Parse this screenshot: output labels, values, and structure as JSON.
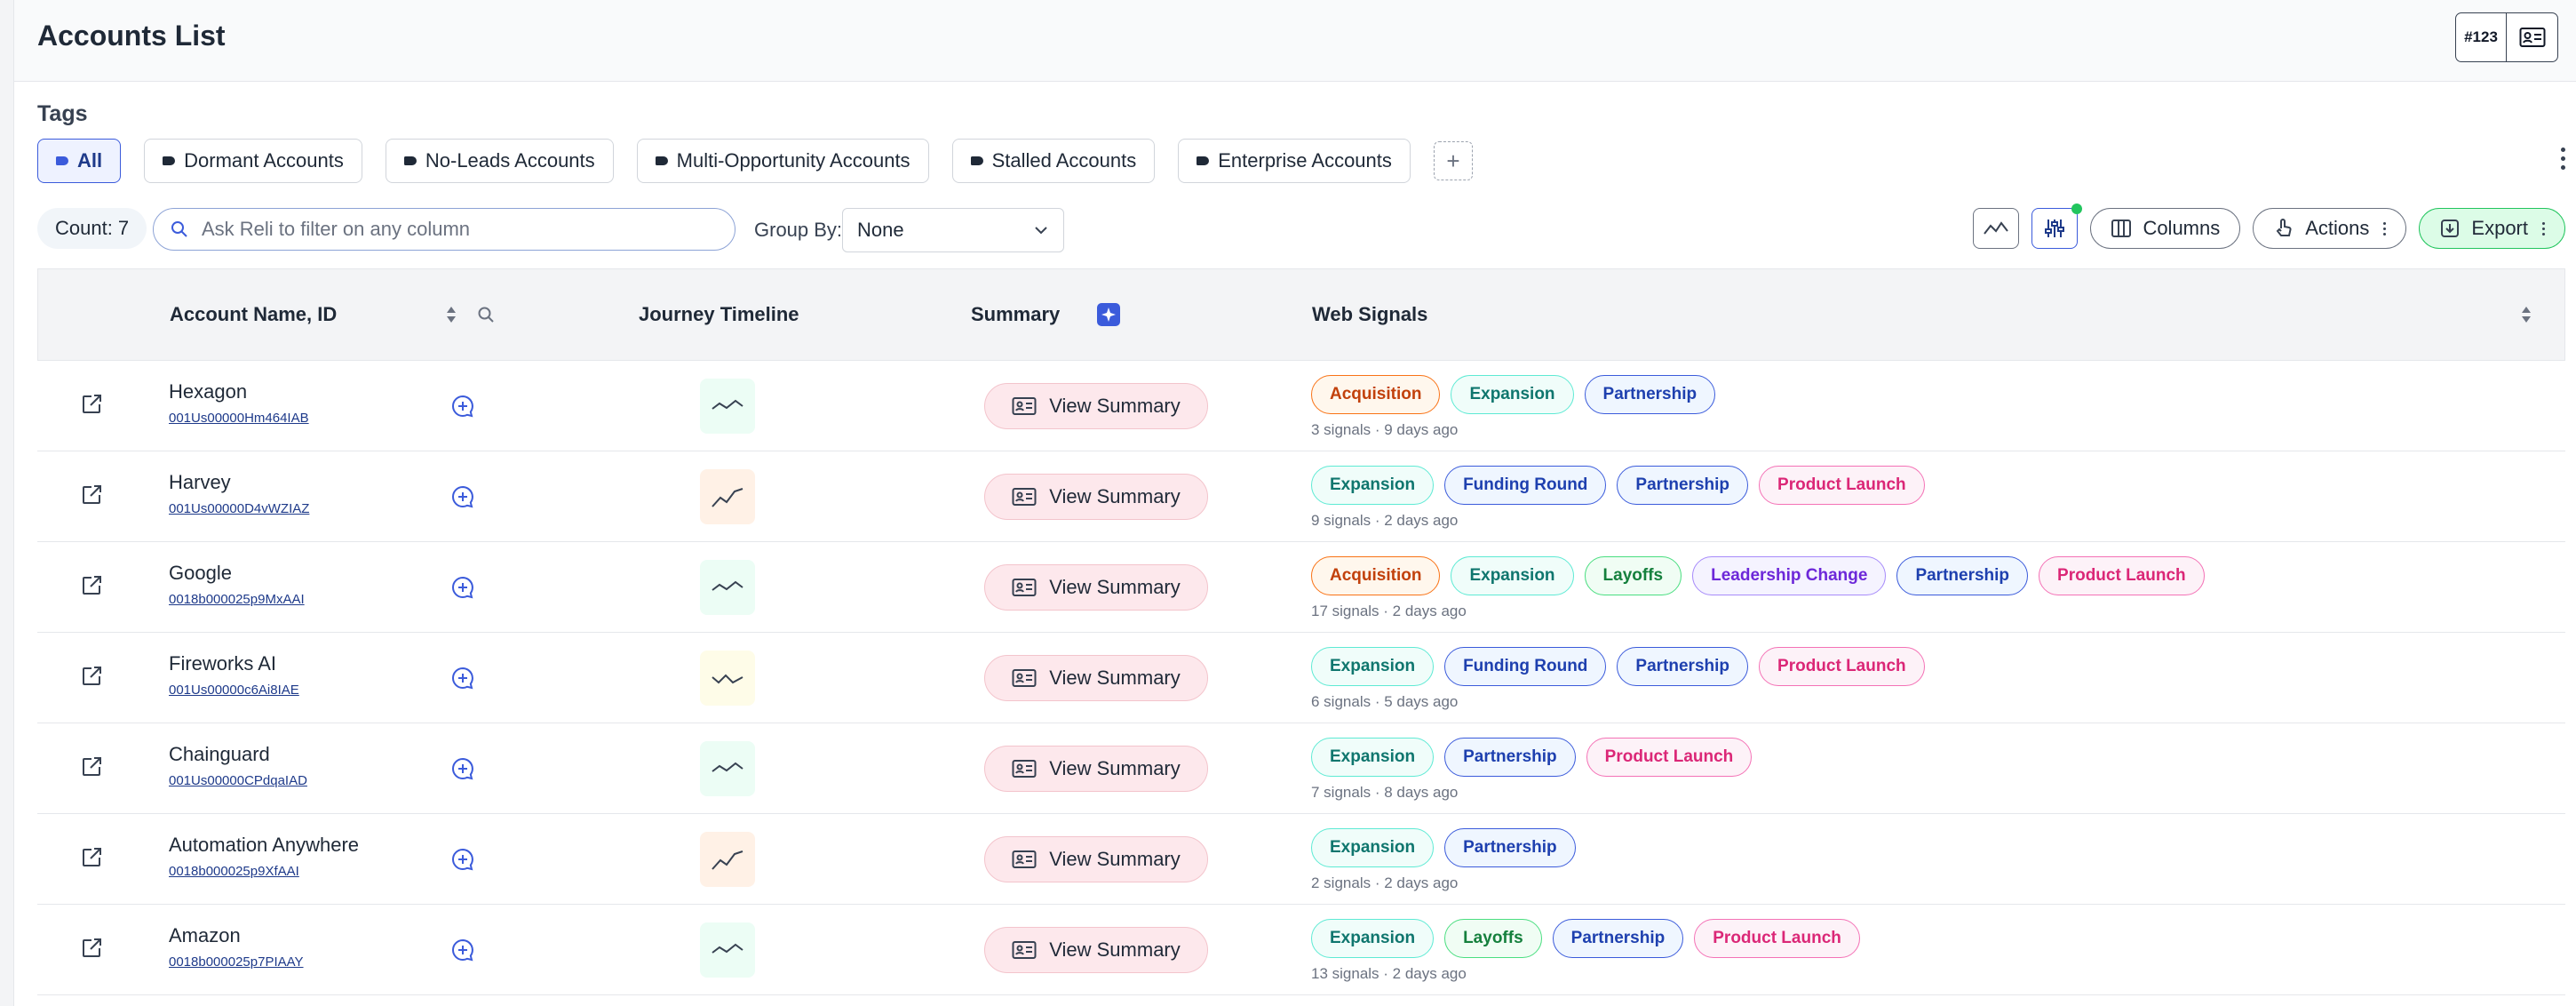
{
  "page": {
    "title": "Accounts List",
    "header_id_label": "#123"
  },
  "tags": {
    "label": "Tags",
    "items": [
      {
        "label": "All",
        "active": true
      },
      {
        "label": "Dormant Accounts"
      },
      {
        "label": "No-Leads Accounts"
      },
      {
        "label": "Multi-Opportunity Accounts"
      },
      {
        "label": "Stalled Accounts"
      },
      {
        "label": "Enterprise Accounts"
      }
    ],
    "add_label": "+"
  },
  "toolbar": {
    "count": "Count: 7",
    "search_placeholder": "Ask Reli to filter on any column",
    "group_by_label": "Group By:",
    "group_by_value": "None",
    "columns_label": "Columns",
    "actions_label": "Actions",
    "export_label": "Export"
  },
  "table": {
    "headers": {
      "account": "Account Name, ID",
      "journey": "Journey Timeline",
      "summary": "Summary",
      "signals": "Web Signals"
    },
    "view_summary_label": "View Summary",
    "rows": [
      {
        "name": "Hexagon",
        "id": "001Us00000Hm464IAB",
        "journey_icon": "trend-flat-icon",
        "journey_color": "green",
        "signals": [
          "Acquisition",
          "Expansion",
          "Partnership"
        ],
        "meta": "3 signals · 9 days ago"
      },
      {
        "name": "Harvey",
        "id": "001Us00000D4vWZIAZ",
        "journey_icon": "trend-up-icon",
        "journey_color": "orange",
        "signals": [
          "Expansion",
          "Funding Round",
          "Partnership",
          "Product Launch"
        ],
        "meta": "9 signals · 2 days ago"
      },
      {
        "name": "Google",
        "id": "0018b000025p9MxAAI",
        "journey_icon": "trend-flat-icon",
        "journey_color": "green",
        "signals": [
          "Acquisition",
          "Expansion",
          "Layoffs",
          "Leadership Change",
          "Partnership",
          "Product Launch"
        ],
        "meta": "17 signals · 2 days ago"
      },
      {
        "name": "Fireworks AI",
        "id": "001Us00000c6Ai8IAE",
        "journey_icon": "trend-wave-icon",
        "journey_color": "yellow",
        "signals": [
          "Expansion",
          "Funding Round",
          "Partnership",
          "Product Launch"
        ],
        "meta": "6 signals · 5 days ago"
      },
      {
        "name": "Chainguard",
        "id": "001Us00000CPdqaIAD",
        "journey_icon": "trend-flat-icon",
        "journey_color": "green",
        "signals": [
          "Expansion",
          "Partnership",
          "Product Launch"
        ],
        "meta": "7 signals · 8 days ago"
      },
      {
        "name": "Automation Anywhere",
        "id": "0018b000025p9XfAAI",
        "journey_icon": "trend-up-icon",
        "journey_color": "orange",
        "signals": [
          "Expansion",
          "Partnership"
        ],
        "meta": "2 signals · 2 days ago"
      },
      {
        "name": "Amazon",
        "id": "0018b000025p7PIAAY",
        "journey_icon": "trend-flat-icon",
        "journey_color": "green",
        "signals": [
          "Expansion",
          "Layoffs",
          "Partnership",
          "Product Launch"
        ],
        "meta": "13 signals · 2 days ago"
      }
    ]
  },
  "signal_colors": {
    "Acquisition": {
      "fg": "#c2410c",
      "bg": "#fff7ed",
      "border": "#f97316"
    },
    "Expansion": {
      "fg": "#0f766e",
      "bg": "#f0fdfa",
      "border": "#5eead4"
    },
    "Partnership": {
      "fg": "#1e40af",
      "bg": "#eff6ff",
      "border": "#3b5bdb"
    },
    "Funding Round": {
      "fg": "#1e40af",
      "bg": "#eff6ff",
      "border": "#3b5bdb"
    },
    "Product Launch": {
      "fg": "#db2777",
      "bg": "#fdf2f8",
      "border": "#f472b6"
    },
    "Layoffs": {
      "fg": "#15803d",
      "bg": "#f0fdf4",
      "border": "#4ade80"
    },
    "Leadership Change": {
      "fg": "#6d28d9",
      "bg": "#f5f3ff",
      "border": "#a78bfa"
    }
  },
  "journey_colors": {
    "green": {
      "bg": "#ecfdf5",
      "stroke": "#374151"
    },
    "orange": {
      "bg": "#fff1e6",
      "stroke": "#374151"
    },
    "yellow": {
      "bg": "#fefce8",
      "stroke": "#374151"
    }
  }
}
